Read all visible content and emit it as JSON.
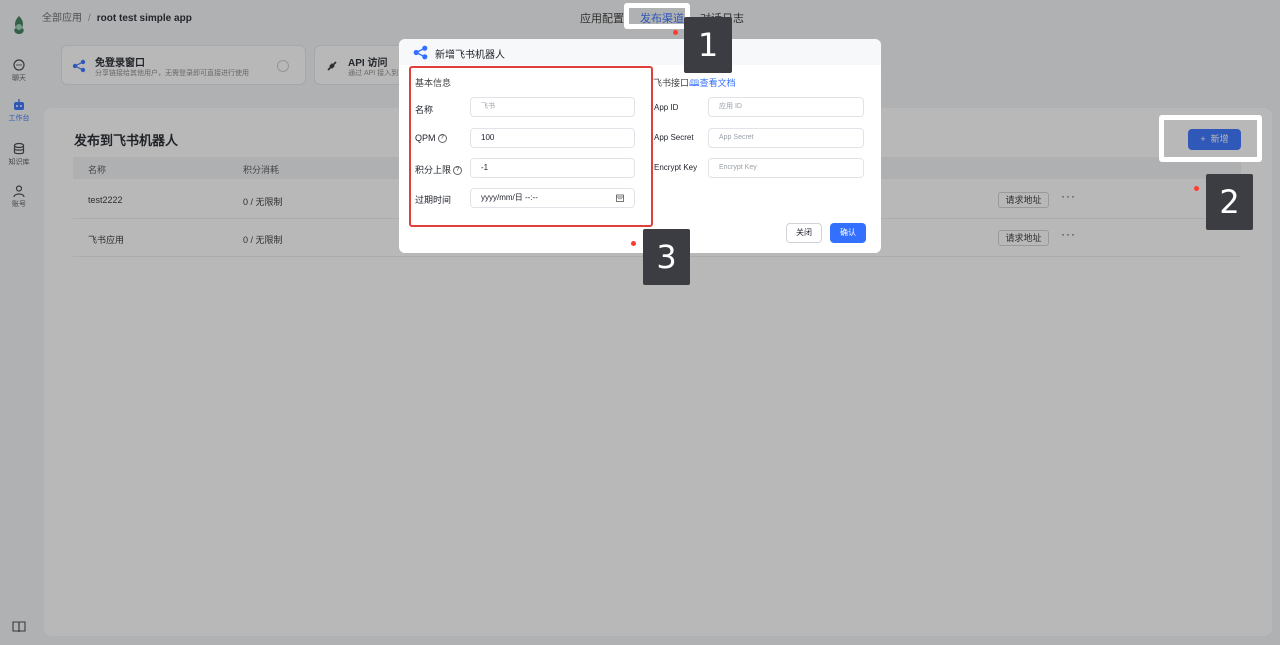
{
  "nav": {
    "items": [
      {
        "label": "聊天",
        "icon": "chat-icon"
      },
      {
        "label": "工作台",
        "icon": "robot-icon"
      },
      {
        "label": "知识库",
        "icon": "database-icon"
      },
      {
        "label": "账号",
        "icon": "user-icon"
      }
    ],
    "bottom_icon": "book-icon"
  },
  "breadcrumb": {
    "root": "全部应用",
    "separator": "/",
    "current": "root test simple app"
  },
  "tabs": [
    "应用配置",
    "发布渠道",
    "对话日志"
  ],
  "features": [
    {
      "title": "免登录窗口",
      "subtitle": "分享链接给其他用户，无需登录即可直接进行使用"
    },
    {
      "title": "API 访问",
      "subtitle": "通过 API 接入到"
    }
  ],
  "panel": {
    "title": "发布到飞书机器人",
    "add_label": "新增",
    "columns": [
      "名称",
      "积分消耗"
    ],
    "rows": [
      {
        "name": "test2222",
        "usage": "0 / 无限制",
        "action": "请求地址",
        "more": "···"
      },
      {
        "name": "飞书应用",
        "usage": "0 / 无限制",
        "action": "请求地址",
        "more": "···"
      }
    ]
  },
  "modal": {
    "title": "新增飞书机器人",
    "basic_section": "基本信息",
    "fields": {
      "name": {
        "label": "名称",
        "placeholder": "飞书"
      },
      "qpm": {
        "label": "QPM",
        "help": "?",
        "value": "100"
      },
      "limit": {
        "label": "积分上限",
        "help": "?",
        "value": "-1"
      },
      "expire": {
        "label": "过期时间",
        "value": "yyyy/mm/日 --:--"
      }
    },
    "feishu_section": "飞书接口",
    "doc_link": "查看文档",
    "right_fields": [
      {
        "label": "App ID",
        "placeholder": "应用 ID"
      },
      {
        "label": "App Secret",
        "placeholder": "App Secret"
      },
      {
        "label": "Encrypt Key",
        "placeholder": "Encrypt Key"
      }
    ],
    "close_label": "关闭",
    "confirm_label": "确认"
  },
  "callouts": [
    "1",
    "2",
    "3"
  ],
  "colors": {
    "accent": "#3370ff",
    "annotation_red": "#e0403a",
    "callout_bg": "#3b3d42"
  }
}
